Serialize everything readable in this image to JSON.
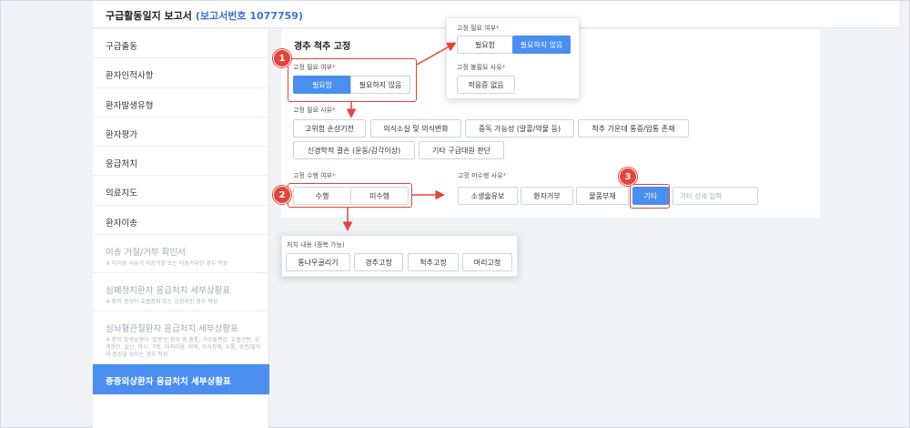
{
  "header": {
    "title": "구급활동일지 보고서",
    "report_no": "(보고서번호 1077759)"
  },
  "sidebar": {
    "items": [
      {
        "label": "구급출동"
      },
      {
        "label": "환자인적사항"
      },
      {
        "label": "환자발생유형"
      },
      {
        "label": "환자평가"
      },
      {
        "label": "응급처치"
      },
      {
        "label": "의료지도"
      },
      {
        "label": "환자이송"
      },
      {
        "label": "이송 거절/거부 확인서",
        "note": "※ 미이송 사유가 이송거절 또는 이송거부인 경우 작성"
      },
      {
        "label": "심폐정지환자 응급처치 세부상황표",
        "note": "※ 환자 증상이 호흡정지 또는 심정지인 경우 작성"
      },
      {
        "label": "심뇌혈관질환자 응급처치 세부상황표",
        "note": "※ 환자 발생유형이 '질병'인 환자 중 흉통, 가슴불편감, 호흡곤란, 심계항진, 실신, 의식, 구토, 어지러움, 마비, 의식장애, 두통, 경련/발작의 증상을 보이는 경우 작성"
      },
      {
        "label": "중증외상환자 응급처치 세부상황표"
      }
    ]
  },
  "main": {
    "section_title": "경추 척추 고정",
    "fix_needed": {
      "label": "고정 필요 여부",
      "req": "*",
      "options": [
        "필요함",
        "필요하지 않음"
      ]
    },
    "fix_reason": {
      "label": "고정 필요 사유",
      "req": "*",
      "options": [
        "고위험 손상기전",
        "의식소실 및 의식변화",
        "중독 가능성 (알콜/약물 등)",
        "척추 가운데 통증/압통 존재",
        "신경학적 결손 (운동/감각이상)",
        "기타 구급대원 판단"
      ]
    },
    "fix_done": {
      "label": "고정 수행 여부",
      "req": "*",
      "options": [
        "수행",
        "미수행"
      ]
    },
    "not_done_reason": {
      "label": "고정 미수행 사유",
      "req": "*",
      "options": [
        "소생술유보",
        "환자거부",
        "물품부재",
        "기타"
      ],
      "input_placeholder": "기타 상세 입력"
    }
  },
  "popup_not_needed": {
    "q_label": "고정 필요 여부",
    "req": "*",
    "options": [
      "필요함",
      "필요하지 않음"
    ],
    "reason_label": "고정 불필요 사유",
    "reason_option": "적응증 없음"
  },
  "popup_treatment": {
    "label": "처치 내용 (중복 가능)",
    "options": [
      "통나무굴리기",
      "경추고정",
      "척추고정",
      "머리고정"
    ]
  },
  "annotations": {
    "badge1": "1",
    "badge2": "2",
    "badge3": "3"
  },
  "colors": {
    "accent": "#4a8ef0",
    "annotation": "#e5433b",
    "report_no": "#3d6fd6"
  }
}
